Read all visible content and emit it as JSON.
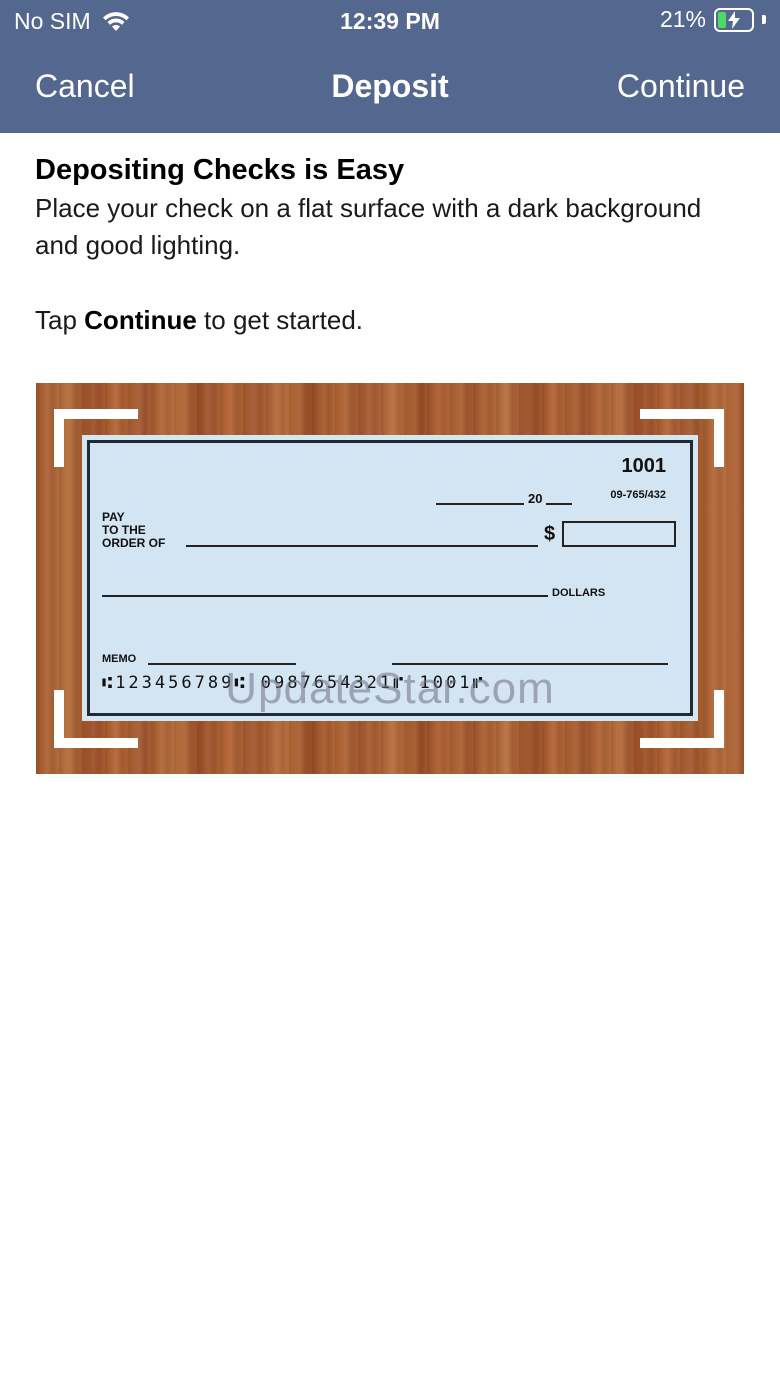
{
  "status_bar": {
    "carrier": "No SIM",
    "time": "12:39 PM",
    "battery_percent": "21%"
  },
  "nav": {
    "cancel_label": "Cancel",
    "title": "Deposit",
    "continue_label": "Continue"
  },
  "intro": {
    "heading": "Depositing Checks is Easy",
    "body": "Place your check on a flat surface with a dark background and good lighting.",
    "tap_prefix": "Tap ",
    "tap_bold": "Continue",
    "tap_suffix": " to get started."
  },
  "check": {
    "number": "1001",
    "date_year": "20",
    "routing_fraction": "09-765/432",
    "pay_line1": "PAY",
    "pay_line2": "TO THE",
    "pay_line3": "ORDER OF",
    "dollar_sign": "$",
    "dollars_label": "DOLLARS",
    "memo_label": "MEMO",
    "micr": "⑆123456789⑆ 0987654321⑈ 1001⑈"
  },
  "watermark": "UpdateStar.com"
}
